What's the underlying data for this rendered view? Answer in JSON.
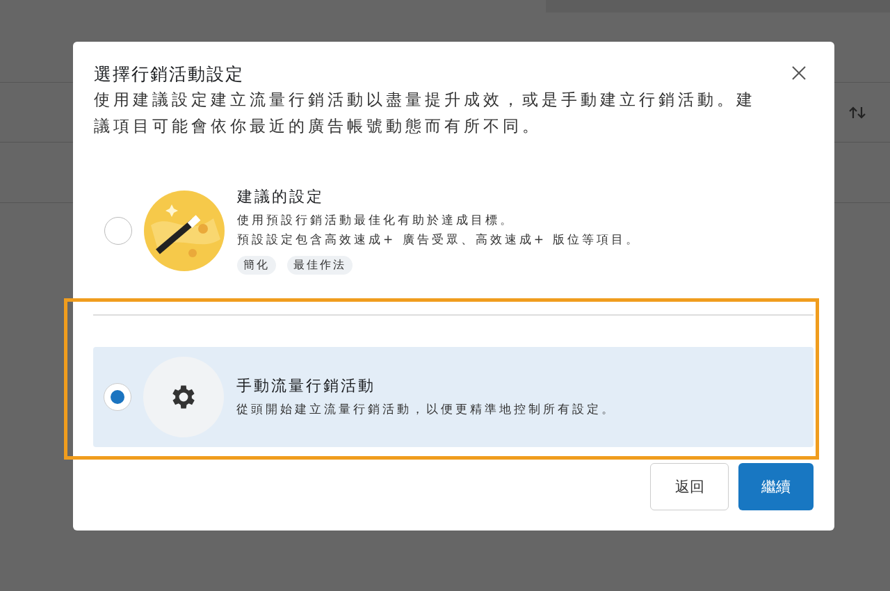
{
  "dialog": {
    "title": "選擇行銷活動設定",
    "description": "使用建議設定建立流量行銷活動以盡量提升成效，或是手動建立行銷活動。建議項目可能會依你最近的廣告帳號動態而有所不同。"
  },
  "options": [
    {
      "kind": "suggested",
      "title": "建議的設定",
      "lines": [
        "使用預設行銷活動最佳化有助於達成目標。",
        "預設設定包含高效速成+ 廣告受眾、高效速成+ 版位等項目。"
      ],
      "tags": [
        "簡化",
        "最佳作法"
      ],
      "selected": false,
      "highlighted": false
    },
    {
      "kind": "manual",
      "title": "手動流量行銷活動",
      "lines": [
        "從頭開始建立流量行銷活動，以便更精準地控制所有設定。"
      ],
      "selected": true,
      "highlighted": true
    }
  ],
  "buttons": [
    {
      "label": "返回",
      "kind": "secondary"
    },
    {
      "label": "繼續",
      "kind": "primary"
    }
  ]
}
